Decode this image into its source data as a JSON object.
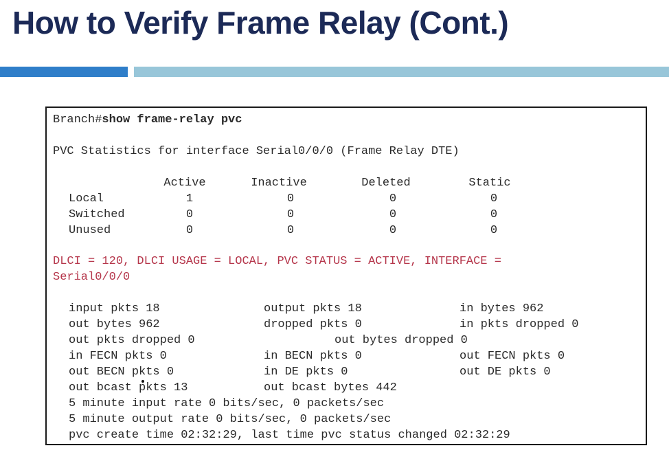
{
  "slide": {
    "title": "How to Verify Frame Relay (Cont.)",
    "accent_colors": {
      "title": "#1c2a57",
      "bar_left": "#2f7ec9",
      "bar_right": "#98c6d9",
      "highlight_text": "#b5354a"
    }
  },
  "terminal": {
    "prompt": "Branch#",
    "command": "show frame-relay pvc",
    "stats_header": "PVC Statistics for interface Serial0/0/0 (Frame Relay DTE)",
    "columns": [
      "Active",
      "Inactive",
      "Deleted",
      "Static"
    ],
    "rows": [
      {
        "label": "Local",
        "values": [
          "1",
          "0",
          "0",
          "0"
        ]
      },
      {
        "label": "Switched",
        "values": [
          "0",
          "0",
          "0",
          "0"
        ]
      },
      {
        "label": "Unused",
        "values": [
          "0",
          "0",
          "0",
          "0"
        ]
      }
    ],
    "dlci_line1": "DLCI = 120, DLCI USAGE = LOCAL, PVC STATUS = ACTIVE, INTERFACE =",
    "dlci_line2": "Serial0/0/0",
    "counters": {
      "input_pkts": "input pkts 18",
      "output_pkts": "output pkts 18",
      "in_bytes": "in bytes 962",
      "out_bytes": "out bytes 962",
      "dropped_pkts": "dropped pkts 0",
      "in_pkts_dropped": "in pkts dropped 0",
      "out_pkts_dropped": "out pkts dropped 0",
      "out_bytes_dropped": "out bytes dropped 0",
      "in_fecn_pkts": "in FECN pkts 0",
      "in_becn_pkts": "in BECN pkts 0",
      "out_fecn_pkts": "out FECN pkts 0",
      "out_becn_pkts": "out BECN pkts 0",
      "in_de_pkts": "in DE pkts 0",
      "out_de_pkts": "out DE pkts 0",
      "out_bcast_pkts": "out bcast pkts 13",
      "out_bcast_bytes": "out bcast bytes 442"
    },
    "rate_input": "5 minute input rate 0 bits/sec, 0 packets/sec",
    "rate_output": "5 minute output rate 0 bits/sec, 0 packets/sec",
    "create_time": "pvc create time 02:32:29, last time pvc status changed 02:32:29"
  }
}
